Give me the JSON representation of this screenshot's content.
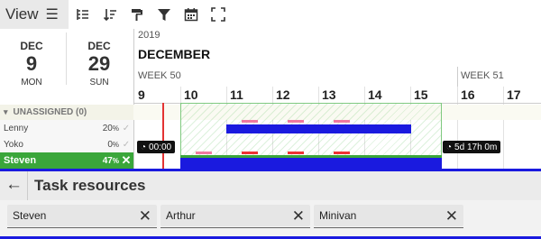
{
  "toolbar": {
    "view_label": "View",
    "icons": [
      "menu-icon",
      "outline-indent-icon",
      "sort-icon",
      "paint-roller-icon",
      "filter-icon",
      "calendar-icon",
      "fullscreen-icon"
    ]
  },
  "range": {
    "start": {
      "month": "DEC",
      "day": "9",
      "weekday": "MON"
    },
    "end": {
      "month": "DEC",
      "day": "29",
      "weekday": "SUN"
    }
  },
  "timeline": {
    "year": "2019",
    "month": "DECEMBER",
    "weeks": [
      "WEEK 50",
      "WEEK 51"
    ],
    "days": [
      "9",
      "10",
      "11",
      "12",
      "13",
      "14",
      "15",
      "16",
      "17"
    ]
  },
  "resources": {
    "group_label": "UNASSIGNED (0)",
    "rows": [
      {
        "name": "Lenny",
        "percent": "20",
        "unit": "%",
        "selected": false
      },
      {
        "name": "Yoko",
        "percent": "0",
        "unit": "%",
        "selected": false
      },
      {
        "name": "Steven",
        "percent": "47",
        "unit": "%",
        "selected": true
      }
    ]
  },
  "timers": {
    "start": "00:00",
    "duration": "5d 17h 0m"
  },
  "sheet": {
    "title": "Task resources",
    "chips": [
      "Steven",
      "Arthur",
      "Minivan"
    ]
  },
  "colors": {
    "accent_green": "#3aa63a",
    "bar_blue": "#1a1adf",
    "today_red": "#e33333",
    "highlight_pink": "#f07aa0"
  }
}
